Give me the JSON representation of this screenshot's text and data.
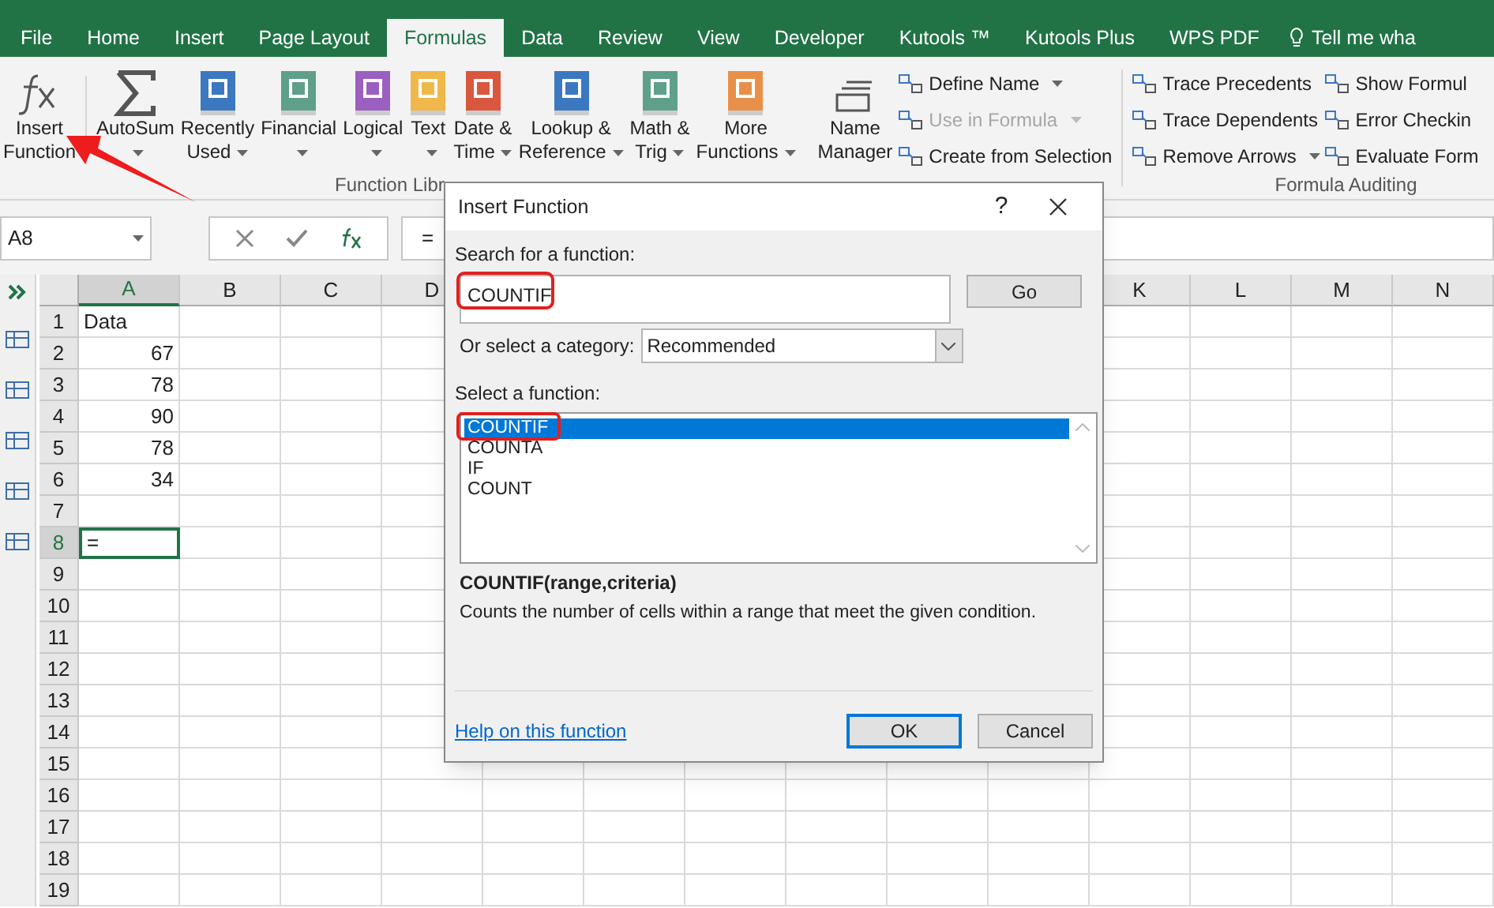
{
  "tabs": [
    {
      "label": "File",
      "selected": false
    },
    {
      "label": "Home",
      "selected": false
    },
    {
      "label": "Insert",
      "selected": false
    },
    {
      "label": "Page Layout",
      "selected": false
    },
    {
      "label": "Formulas",
      "selected": true
    },
    {
      "label": "Data",
      "selected": false
    },
    {
      "label": "Review",
      "selected": false
    },
    {
      "label": "View",
      "selected": false
    },
    {
      "label": "Developer",
      "selected": false
    },
    {
      "label": "Kutools ™",
      "selected": false
    },
    {
      "label": "Kutools Plus",
      "selected": false
    },
    {
      "label": "WPS PDF",
      "selected": false
    }
  ],
  "tell_me": "Tell me wha",
  "function_library": {
    "label": "Function Libr",
    "buttons": [
      {
        "kind": "fx",
        "lines": [
          "Insert",
          "Function"
        ],
        "dropdown": false
      },
      {
        "kind": "sigma",
        "lines": [
          "AutoSum"
        ],
        "dropdown": true
      },
      {
        "kind": "book",
        "color": "#3c78c0",
        "lines": [
          "Recently",
          "Used"
        ],
        "dropdown": true
      },
      {
        "kind": "book",
        "color": "#5ea08a",
        "lines": [
          "Financial"
        ],
        "dropdown": true
      },
      {
        "kind": "book",
        "color": "#9b5fbf",
        "lines": [
          "Logical"
        ],
        "dropdown": true
      },
      {
        "kind": "book",
        "color": "#f0b84a",
        "lines": [
          "Text"
        ],
        "dropdown": true
      },
      {
        "kind": "book",
        "color": "#d9573e",
        "lines": [
          "Date &",
          "Time"
        ],
        "dropdown": true
      },
      {
        "kind": "book",
        "color": "#3c78c0",
        "lines": [
          "Lookup &",
          "Reference"
        ],
        "dropdown": true
      },
      {
        "kind": "book",
        "color": "#5ea08a",
        "lines": [
          "Math &",
          "Trig"
        ],
        "dropdown": true
      },
      {
        "kind": "book",
        "color": "#e8904a",
        "lines": [
          "More",
          "Functions"
        ],
        "dropdown": true
      }
    ]
  },
  "defined_names": {
    "manager": [
      "Name",
      "Manager"
    ],
    "items": [
      {
        "label": "Define Name",
        "disabled": false,
        "dropdown": true
      },
      {
        "label": "Use in Formula",
        "disabled": true,
        "dropdown": true
      },
      {
        "label": "Create from Selection",
        "disabled": false,
        "dropdown": false
      }
    ]
  },
  "formula_auditing": {
    "label": "Formula Auditing",
    "items": [
      {
        "label": "Trace Precedents",
        "dropdown": false
      },
      {
        "label": "Show Formul",
        "dropdown": false
      },
      {
        "label": "Trace Dependents",
        "dropdown": false
      },
      {
        "label": "Error Checkin",
        "dropdown": false
      },
      {
        "label": "Remove Arrows",
        "dropdown": true
      },
      {
        "label": "Evaluate Form",
        "dropdown": false
      }
    ]
  },
  "formula_bar": {
    "name_box": "A8",
    "formula": "="
  },
  "grid": {
    "columns": [
      {
        "label": "A",
        "selected": true
      },
      {
        "label": "B",
        "selected": false
      },
      {
        "label": "C",
        "selected": false
      },
      {
        "label": "D",
        "selected": false
      },
      {
        "label": "K",
        "selected": false
      },
      {
        "label": "L",
        "selected": false
      },
      {
        "label": "M",
        "selected": false
      },
      {
        "label": "N",
        "selected": false
      }
    ],
    "rows": [
      {
        "header": "1",
        "selected": false,
        "cell_a": {
          "value": "Data",
          "kind": "text",
          "active": false
        }
      },
      {
        "header": "2",
        "selected": false,
        "cell_a": {
          "value": "67",
          "kind": "number",
          "active": false
        }
      },
      {
        "header": "3",
        "selected": false,
        "cell_a": {
          "value": "78",
          "kind": "number",
          "active": false
        }
      },
      {
        "header": "4",
        "selected": false,
        "cell_a": {
          "value": "90",
          "kind": "number",
          "active": false
        }
      },
      {
        "header": "5",
        "selected": false,
        "cell_a": {
          "value": "78",
          "kind": "number",
          "active": false
        }
      },
      {
        "header": "6",
        "selected": false,
        "cell_a": {
          "value": "34",
          "kind": "number",
          "active": false
        }
      },
      {
        "header": "7",
        "selected": false
      },
      {
        "header": "8",
        "selected": true,
        "cell_a": {
          "value": "=",
          "kind": "text",
          "active": true
        }
      },
      {
        "header": "9",
        "selected": false
      },
      {
        "header": "10",
        "selected": false
      },
      {
        "header": "11",
        "selected": false
      },
      {
        "header": "12",
        "selected": false
      },
      {
        "header": "13",
        "selected": false
      },
      {
        "header": "14",
        "selected": false
      },
      {
        "header": "15",
        "selected": false
      },
      {
        "header": "16",
        "selected": false
      },
      {
        "header": "17",
        "selected": false
      },
      {
        "header": "18",
        "selected": false
      },
      {
        "header": "19",
        "selected": false
      }
    ]
  },
  "dialog": {
    "title": "Insert Function",
    "help": "?",
    "search_label": "Search for a function:",
    "search_value": "COUNTIF",
    "go": "Go",
    "category_label": "Or select a category:",
    "category": "Recommended",
    "list_label": "Select a function:",
    "functions": [
      {
        "label": "COUNTIF",
        "selected": true
      },
      {
        "label": "COUNTA",
        "selected": false
      },
      {
        "label": "IF",
        "selected": false
      },
      {
        "label": "COUNT",
        "selected": false
      }
    ],
    "signature": "COUNTIF(range,criteria)",
    "description": "Counts the number of cells within a range that meet the given condition.",
    "help_link": "Help on this function",
    "ok": "OK",
    "cancel": "Cancel"
  }
}
